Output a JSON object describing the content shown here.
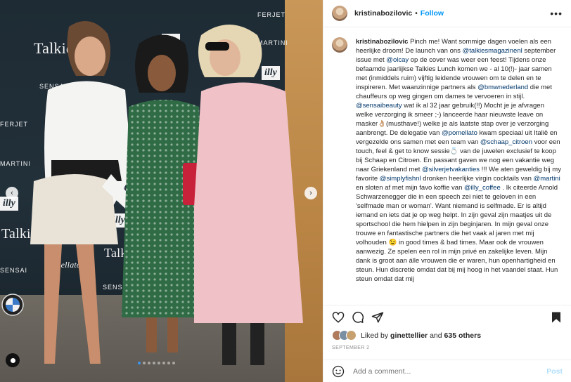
{
  "photo": {
    "logos": [
      "MARTINI",
      "illy",
      "Talkies",
      "SENSAI",
      "Pomellato",
      "FERJET"
    ],
    "carousel": {
      "count": 8,
      "active_index": 0
    }
  },
  "post": {
    "username": "kristinabozilovic",
    "follow_label": "Follow",
    "separator": "•",
    "caption": [
      {
        "t": "Pinch me! Want sommige dagen voelen als een heerlijke droom! De launch van ons "
      },
      {
        "m": "@talkiesmagazinenl"
      },
      {
        "t": " september issue met "
      },
      {
        "m": "@olcay"
      },
      {
        "t": " op de cover was weer een feest! Tijdens onze befaamde jaarlijkse Talkies Lunch komen we - al 10(!)- jaar samen met (inmiddels ruim) vijftig leidende vrouwen om te delen en te inspireren. Met waanzinnige partners als "
      },
      {
        "m": "@bmwnederland"
      },
      {
        "t": " die met chauffeurs op weg gingen om dames te vervoeren in stijl. "
      },
      {
        "m": "@sensaibeauty"
      },
      {
        "t": " wat ik al 32 jaar gebruik(!!) Mocht je je afvragen welke verzorging ik smeer ;-) lanceerde haar nieuwste leave on masker👌🏼(musthave!) welke je als laatste stap over je verzorging aanbrengt. De delegatie van "
      },
      {
        "m": "@pomellato"
      },
      {
        "t": " kwam speciaal uit Italië en vergezelde ons samen met een team van "
      },
      {
        "m": "@schaap_citroen"
      },
      {
        "t": " voor een touch, feel & get to know sessie💍 van de juwelen exclusief te koop bij Schaap en Citroen. En passant gaven we nog een vakantie weg naar Griekenland met "
      },
      {
        "m": "@silverjetvakanties"
      },
      {
        "t": " !!! We aten geweldig bij my favorite "
      },
      {
        "m": "@simplyfishnl"
      },
      {
        "t": " dronken heerlijke virgin cocktails van "
      },
      {
        "m": "@martini"
      },
      {
        "t": " en sloten af met mijn favo koffie van "
      },
      {
        "m": "@illy_coffee"
      },
      {
        "t": " . Ik citeerde Arnold Schwarzenegger die in een speech zei niet te geloven in een 'selfmade man or woman'. Want niemand is selfmade. Er is altijd iemand en iets dat je op weg helpt. In zijn geval zijn maatjes uit de sportschool die hem hielpen in zijn beginjaren. In mijn geval onze trouwe en fantastische partners die het vaak al jaren met mij volhouden 😉 in good times & bad times. Maar ook de vrouwen aanwezig. Ze spelen een rol in mijn privé en zakelijke leven. Mijn dank is groot aan álle vrouwen die er waren, hun openhartigheid en steun. Hun discretie omdat dat bij mij hoog in het vaandel staat. Hun steun omdat dat mij"
      }
    ],
    "likes": {
      "prefix": "Liked by",
      "user": "ginettellier",
      "and": "and",
      "count": "635 others"
    },
    "date": "SEPTEMBER 2",
    "comment_placeholder": "Add a comment...",
    "post_label": "Post"
  },
  "colors": {
    "accent": "#0095f6",
    "mention": "#00376b",
    "post_disabled": "#b2dffc"
  }
}
